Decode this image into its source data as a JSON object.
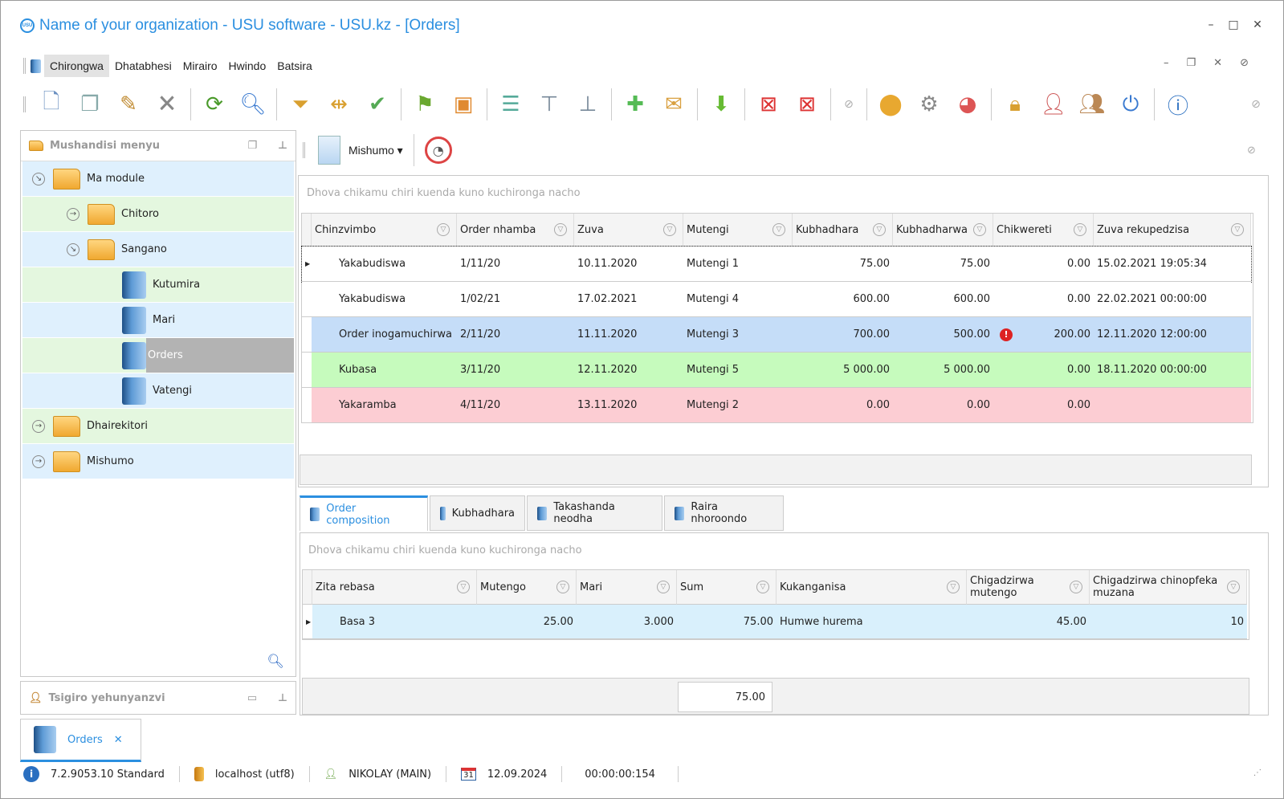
{
  "window": {
    "title": "Name of your organization - USU software - USU.kz - [Orders]",
    "logo": "USU",
    "controls": [
      "minimize",
      "maximize",
      "close"
    ]
  },
  "menu": {
    "items": [
      "Chirongwa",
      "Dhatabhesi",
      "Mirairo",
      "Hwindo",
      "Batsira"
    ],
    "active": "Chirongwa"
  },
  "toolbar": {
    "icons": [
      "add-document-icon",
      "copy-document-icon",
      "edit-document-icon",
      "delete-document-icon",
      "refresh-icon",
      "search-icon",
      "filter-icon",
      "column-filter-icon",
      "filter-check-icon",
      "flag-icon",
      "image-icon",
      "expand-group-icon",
      "tree-down-icon",
      "tree-up-icon",
      "add-row-icon",
      "notes-icon",
      "download-icon",
      "close-window-icon",
      "close-all-windows-icon",
      "collapse-icon",
      "map-pin-icon",
      "settings-icon",
      "color-wheel-icon",
      "lock-icon",
      "user-key-icon",
      "users-icon",
      "plug-icon",
      "info-icon",
      "collapse-icon"
    ]
  },
  "left_panel": {
    "title": "Mushandisi menyu",
    "tree": [
      {
        "label": "Ma module",
        "level": 0,
        "type": "folder",
        "expanded": true
      },
      {
        "label": "Chitoro",
        "level": 1,
        "type": "folder",
        "expanded": false
      },
      {
        "label": "Sangano",
        "level": 1,
        "type": "folder",
        "expanded": true
      },
      {
        "label": "Kutumira",
        "level": 2,
        "type": "book"
      },
      {
        "label": "Mari",
        "level": 2,
        "type": "book"
      },
      {
        "label": "Orders",
        "level": 2,
        "type": "book",
        "selected": true
      },
      {
        "label": "Vatengi",
        "level": 2,
        "type": "book"
      },
      {
        "label": "Dhairekitori",
        "level": 0,
        "type": "folder",
        "expanded": false
      },
      {
        "label": "Mishumo",
        "level": 0,
        "type": "folder",
        "expanded": false
      }
    ]
  },
  "bottom_left_panel": {
    "title": "Tsigiro yehunyanzvi"
  },
  "main_toolbar": {
    "reports_label": "Mishumo"
  },
  "orders_grid": {
    "group_hint": "Dhova chikamu chiri kuenda kuno kuchironga nacho",
    "columns": [
      "Chinzvimbo",
      "Order nhamba",
      "Zuva",
      "Mutengi",
      "Kubhadhara",
      "Kubhadharwa",
      "Chikwereti",
      "Zuva rekupedzisa"
    ],
    "rows": [
      {
        "cells": [
          "Yakabudiswa",
          "1/11/20",
          "10.11.2020",
          "Mutengi 1",
          "75.00",
          "75.00",
          "0.00",
          "15.02.2021 19:05:34"
        ],
        "color": "#ffffff",
        "current": true
      },
      {
        "cells": [
          "Yakabudiswa",
          "1/02/21",
          "17.02.2021",
          "Mutengi 4",
          "600.00",
          "600.00",
          "0.00",
          "22.02.2021 00:00:00"
        ],
        "color": "#ffffff"
      },
      {
        "cells": [
          "Order inogamuchirwa",
          "2/11/20",
          "11.11.2020",
          "Mutengi 3",
          "700.00",
          "500.00",
          "200.00",
          "12.11.2020 12:00:00"
        ],
        "color": "#c5ddf8",
        "warning": true
      },
      {
        "cells": [
          "Kubasa",
          "3/11/20",
          "12.11.2020",
          "Mutengi 5",
          "5 000.00",
          "5 000.00",
          "0.00",
          "18.11.2020 00:00:00"
        ],
        "color": "#c6fbbd"
      },
      {
        "cells": [
          "Yakaramba",
          "4/11/20",
          "13.11.2020",
          "Mutengi 2",
          "0.00",
          "0.00",
          "0.00",
          ""
        ],
        "color": "#fccdd3"
      }
    ]
  },
  "detail_tabs": [
    "Order composition",
    "Kubhadhara",
    "Takashanda neodha",
    "Raira nhoroondo"
  ],
  "detail_grid": {
    "group_hint": "Dhova chikamu chiri kuenda kuno kuchironga nacho",
    "columns": [
      "Zita rebasa",
      "Mutengo",
      "Mari",
      "Sum",
      "Kukanganisa",
      "Chigadzirwa mutengo",
      "Chigadzirwa chinopfeka muzana"
    ],
    "rows": [
      {
        "cells": [
          "Basa 3",
          "25.00",
          "3.000",
          "75.00",
          "Humwe hurema",
          "45.00",
          "10"
        ],
        "color": "#d9f0fc"
      }
    ],
    "total": "75.00"
  },
  "open_tabs": [
    {
      "label": "Orders",
      "close": "✕"
    }
  ],
  "status": {
    "version": "7.2.9053.10 Standard",
    "db": "localhost (utf8)",
    "user": "NIKOLAY (MAIN)",
    "date": "12.09.2024",
    "timer": "00:00:00:154",
    "calendar_day": "31"
  }
}
